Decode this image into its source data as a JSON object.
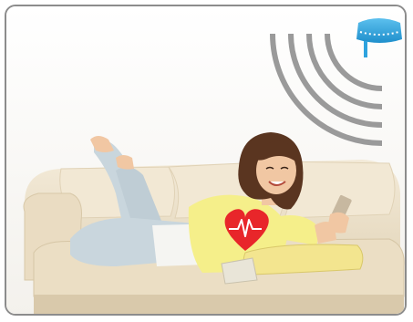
{
  "scene": {
    "description_icons": [
      "ceiling-sensor-icon",
      "radio-wave-icon",
      "heart-pulse-icon"
    ],
    "colors": {
      "sensor": "#2ea3de",
      "waves": "#9a9a9a",
      "heart": "#e8262a",
      "sofa": "#efe4cf",
      "sweater": "#f5ef8a",
      "jeans": "#c9d6dd",
      "hair": "#5a3520",
      "skin": "#f1c7a3",
      "pillow": "#f3e58f"
    }
  }
}
